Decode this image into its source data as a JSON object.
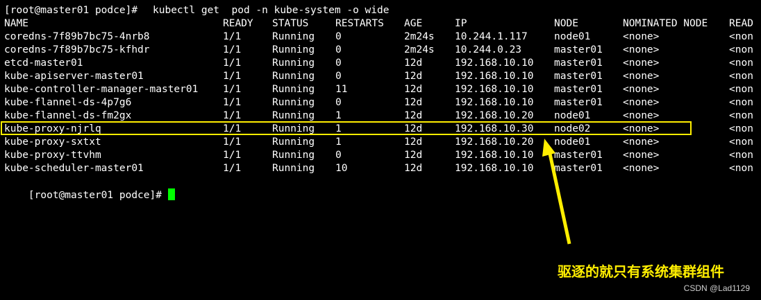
{
  "terminal": {
    "command_prompt": "[root@master01 podce]# ",
    "command": "kubectl get  pod -n kube-system -o wide",
    "final_prompt": "[root@master01 podce]# ",
    "cursor_color": "#00ff00"
  },
  "table": {
    "headers": [
      "NAME",
      "READY",
      "STATUS",
      "RESTARTS",
      "AGE",
      "IP",
      "NODE",
      "NOMINATED NODE",
      "READ"
    ],
    "rows": [
      [
        "coredns-7f89b7bc75-4nrb8",
        "1/1",
        "Running",
        "0",
        "2m24s",
        "10.244.1.117",
        "node01",
        "<none>",
        "<non"
      ],
      [
        "coredns-7f89b7bc75-kfhdr",
        "1/1",
        "Running",
        "0",
        "2m24s",
        "10.244.0.23",
        "master01",
        "<none>",
        "<non"
      ],
      [
        "etcd-master01",
        "1/1",
        "Running",
        "0",
        "12d",
        "192.168.10.10",
        "master01",
        "<none>",
        "<non"
      ],
      [
        "kube-apiserver-master01",
        "1/1",
        "Running",
        "0",
        "12d",
        "192.168.10.10",
        "master01",
        "<none>",
        "<non"
      ],
      [
        "kube-controller-manager-master01",
        "1/1",
        "Running",
        "11",
        "12d",
        "192.168.10.10",
        "master01",
        "<none>",
        "<non"
      ],
      [
        "kube-flannel-ds-4p7g6",
        "1/1",
        "Running",
        "0",
        "12d",
        "192.168.10.10",
        "master01",
        "<none>",
        "<non"
      ],
      [
        "kube-flannel-ds-fm2gx",
        "1/1",
        "Running",
        "1",
        "12d",
        "192.168.10.20",
        "node01",
        "<none>",
        "<non"
      ],
      [
        "kube-proxy-njrlq",
        "1/1",
        "Running",
        "1",
        "12d",
        "192.168.10.30",
        "node02",
        "<none>",
        "<non"
      ],
      [
        "kube-proxy-sxtxt",
        "1/1",
        "Running",
        "1",
        "12d",
        "192.168.10.20",
        "node01",
        "<none>",
        "<non"
      ],
      [
        "kube-proxy-ttvhm",
        "1/1",
        "Running",
        "0",
        "12d",
        "192.168.10.10",
        "master01",
        "<none>",
        "<non"
      ],
      [
        "kube-scheduler-master01",
        "1/1",
        "Running",
        "10",
        "12d",
        "192.168.10.10",
        "master01",
        "<none>",
        "<non"
      ]
    ],
    "highlighted_row_name": "kube-proxy-njrlq"
  },
  "annotation": {
    "text": "驱逐的就只有系统集群组件",
    "color": "#ffee00"
  },
  "watermark": "CSDN @Lad1129"
}
